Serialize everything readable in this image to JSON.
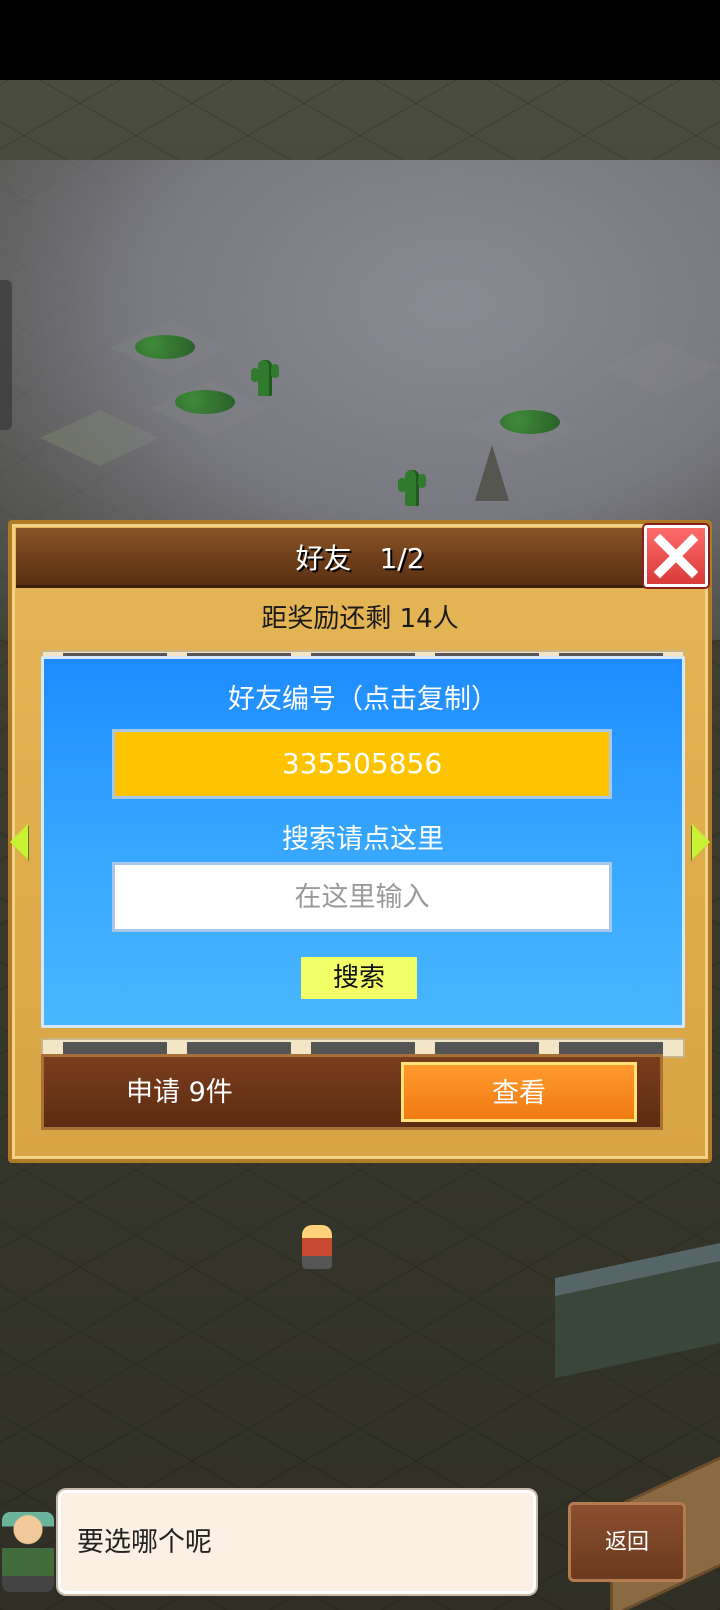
{
  "dialog": {
    "title": "好友　1/2",
    "reward_text": "距奖励还剩 14人",
    "friend_id_label": "好友编号（点击复制）",
    "friend_id": "335505856",
    "search_label": "搜索请点这里",
    "search_placeholder": "在这里输入",
    "search_button": "搜索",
    "request_text": "申请 9件",
    "view_button": "查看"
  },
  "bottom": {
    "message": "要选哪个呢",
    "back_button": "返回"
  },
  "icons": {
    "close": "close-icon",
    "prev": "arrow-left-icon",
    "next": "arrow-right-icon"
  },
  "colors": {
    "panel_blue": "#1e8cff",
    "friend_id_bg": "#ffc400",
    "search_button_bg": "#f2ff66",
    "view_button_bg": "#f07b12",
    "close_button_bg": "#e64a4a"
  }
}
